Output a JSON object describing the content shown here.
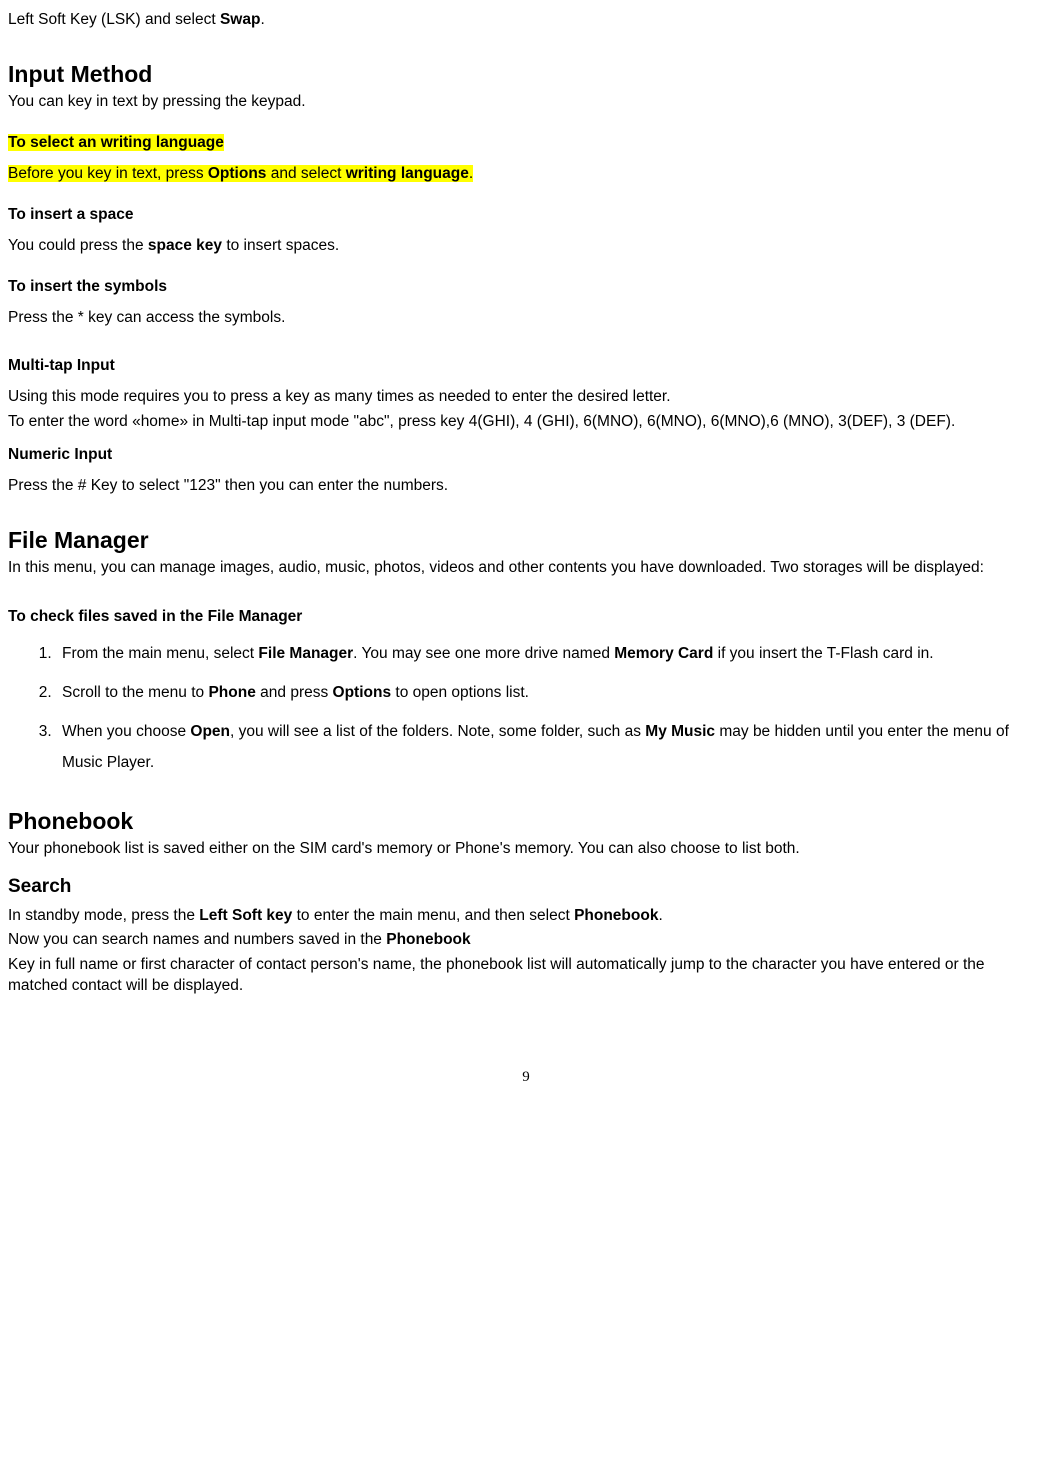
{
  "intro": {
    "prefix": "Left Soft Key (LSK) and select ",
    "bold": "Swap",
    "suffix": "."
  },
  "inputMethod": {
    "heading": "Input Method",
    "desc": "You can key in text by pressing the keypad.",
    "writingLangHead": "To select an writing language",
    "writingLangBody": {
      "t1": "Before you key in text, press ",
      "b1": "Options",
      "t2": " and select ",
      "b2": "writing language",
      "t3": "."
    },
    "spaceHead": "To insert a space",
    "spaceBody": {
      "t1": "You could press the ",
      "b1": "space key",
      "t2": " to insert spaces."
    },
    "symbolsHead": "To insert the symbols",
    "symbolsBody": "Press the * key can access the symbols.",
    "multiHead": "Multi-tap Input",
    "multiBody1": "Using this mode requires you to press a key as many times as needed to enter the desired letter.",
    "multiBody2": "To enter the word «home» in Multi-tap input mode \"abc\", press key 4(GHI), 4 (GHI), 6(MNO), 6(MNO), 6(MNO),6 (MNO), 3(DEF), 3 (DEF).",
    "numHead": "Numeric Input",
    "numBody": "Press the # Key to select \"123\" then you can enter the numbers."
  },
  "fileManager": {
    "heading": "File Manager",
    "desc": "In this menu, you can manage images, audio, music, photos, videos and other contents you have downloaded. Two storages will be displayed:",
    "checkHead": "To check files saved in the File Manager",
    "items": [
      {
        "t1": "From the main menu, select ",
        "b1": "File Manager",
        "t2": ". You may see one more drive named ",
        "b2": "Memory Card",
        "t3": " if you insert the T-Flash card in."
      },
      {
        "t1": "Scroll to the menu to ",
        "b1": "Phone",
        "t2": " and press ",
        "b2": "Options",
        "t3": " to open options list."
      },
      {
        "t1": "When you choose ",
        "b1": "Open",
        "t2": ", you will see a list of the folders. Note, some folder, such as ",
        "b2": "My Music",
        "t3": " may be hidden until you enter the menu of Music Player."
      }
    ]
  },
  "phonebook": {
    "heading": "Phonebook",
    "desc": "Your phonebook list is saved either on the SIM card's memory or Phone's memory. You can also choose to list both.",
    "searchHead": "Search",
    "search1": {
      "t1": "In standby mode, press the ",
      "b1": "Left Soft key",
      "t2": " to enter the main menu, and then select ",
      "b2": "Phonebook",
      "t3": "."
    },
    "search2": {
      "t1": "Now you can search names and numbers saved in the ",
      "b1": "Phonebook"
    },
    "search3": "Key in full name or first character of contact person's name, the phonebook list will automatically jump to the character you have entered or the matched contact will be displayed."
  },
  "pageNumber": "9"
}
